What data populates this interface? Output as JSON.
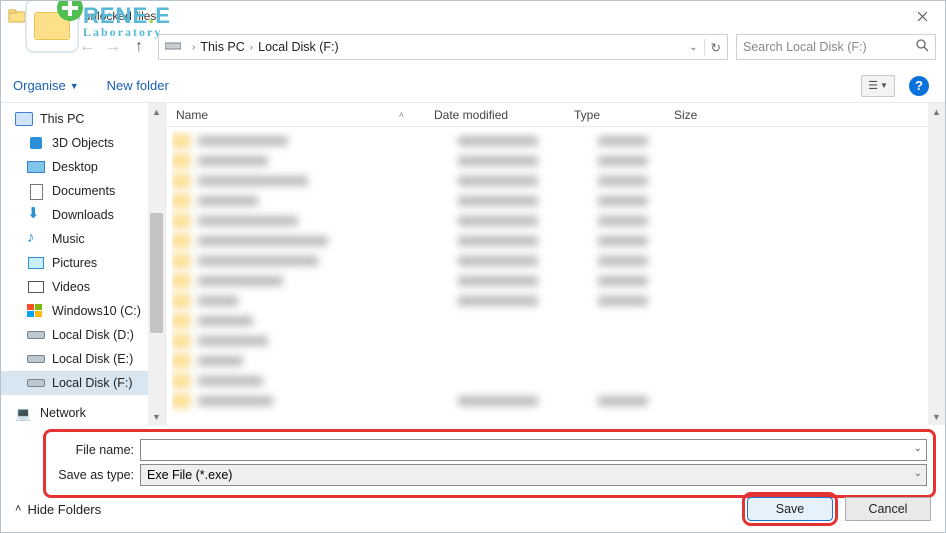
{
  "title": "Save the unlocked files",
  "brand": {
    "line1_a": "RENE",
    "line1_b": "E",
    "line2": "Laboratory"
  },
  "breadcrumb": {
    "a": "This PC",
    "b": "Local Disk (F:)"
  },
  "search": {
    "placeholder": "Search Local Disk (F:)"
  },
  "toolbar": {
    "organise": "Organise",
    "newfolder": "New folder"
  },
  "columns": {
    "name": "Name",
    "date": "Date modified",
    "type": "Type",
    "size": "Size"
  },
  "tree": {
    "head": "This PC",
    "items": [
      "3D Objects",
      "Desktop",
      "Documents",
      "Downloads",
      "Music",
      "Pictures",
      "Videos",
      "Windows10 (C:)",
      "Local Disk (D:)",
      "Local Disk (E:)",
      "Local Disk (F:)"
    ],
    "selected": "Local Disk (F:)",
    "network": "Network"
  },
  "form": {
    "filename_label": "File name:",
    "filename_value": "",
    "type_label": "Save as type:",
    "type_value": "Exe File (*.exe)"
  },
  "footer": {
    "hide": "Hide Folders",
    "save": "Save",
    "cancel": "Cancel"
  }
}
